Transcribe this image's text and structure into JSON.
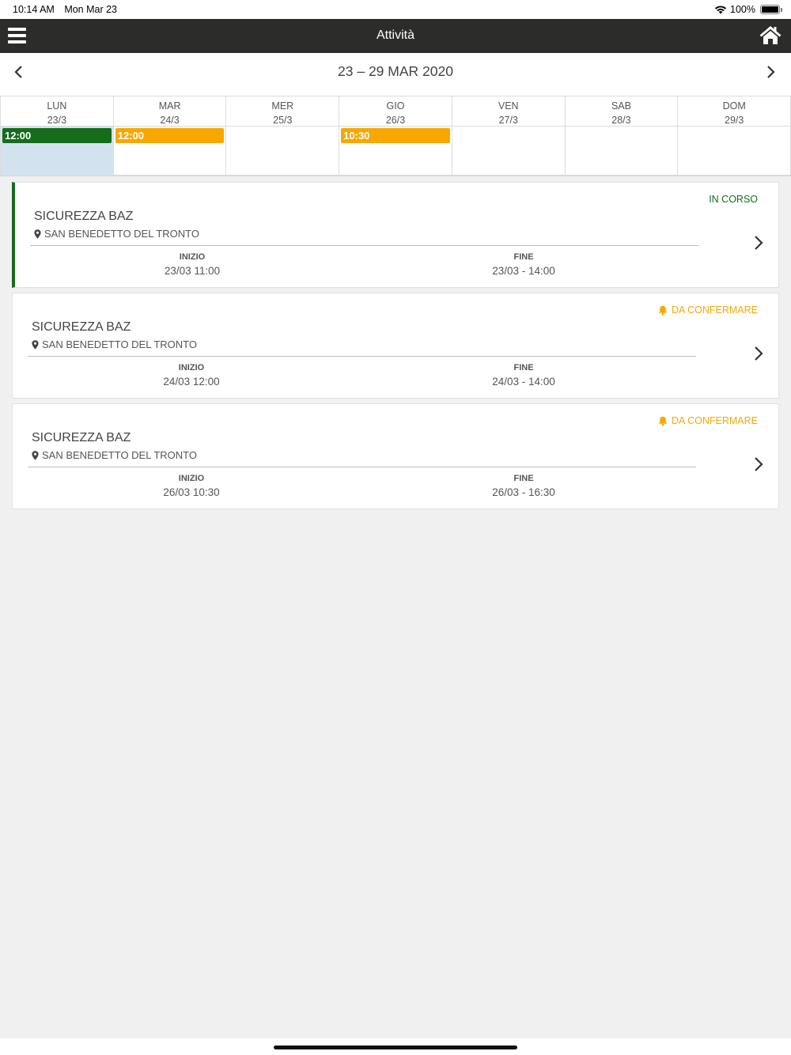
{
  "status_bar": {
    "time": "10:14 AM",
    "date": "Mon Mar 23",
    "battery": "100%",
    "battery_level": 1.0
  },
  "nav": {
    "title": "Attività",
    "menu_icon": "hamburger-icon",
    "home_icon": "home-icon"
  },
  "week": {
    "title": "23 – 29 MAR 2020"
  },
  "days": [
    {
      "name": "LUN",
      "date": "23/3",
      "today": true,
      "event": {
        "time": "12:00",
        "color": "#156c1b"
      }
    },
    {
      "name": "MAR",
      "date": "24/3",
      "today": false,
      "event": {
        "time": "12:00",
        "color": "#f7a800"
      }
    },
    {
      "name": "MER",
      "date": "25/3",
      "today": false,
      "event": null
    },
    {
      "name": "GIO",
      "date": "26/3",
      "today": false,
      "event": {
        "time": "10:30",
        "color": "#f7a800"
      }
    },
    {
      "name": "VEN",
      "date": "27/3",
      "today": false,
      "event": null
    },
    {
      "name": "SAB",
      "date": "28/3",
      "today": false,
      "event": null
    },
    {
      "name": "DOM",
      "date": "29/3",
      "today": false,
      "event": null
    }
  ],
  "labels": {
    "start": "INIZIO",
    "end": "FINE"
  },
  "colors": {
    "in_progress": "#156c1b",
    "pending": "#f7a800"
  },
  "activities": [
    {
      "title": "SICUREZZA BAZ",
      "location": "SAN BENEDETTO DEL TRONTO",
      "status": "IN CORSO",
      "status_type": "in_progress",
      "start": "23/03 11:00",
      "end": "23/03 - 14:00"
    },
    {
      "title": "SICUREZZA BAZ",
      "location": "SAN BENEDETTO DEL TRONTO",
      "status": "DA CONFERMARE",
      "status_type": "pending",
      "start": "24/03 12:00",
      "end": "24/03 - 14:00"
    },
    {
      "title": "SICUREZZA BAZ",
      "location": "SAN BENEDETTO DEL TRONTO",
      "status": "DA CONFERMARE",
      "status_type": "pending",
      "start": "26/03 10:30",
      "end": "26/03 - 16:30"
    }
  ]
}
